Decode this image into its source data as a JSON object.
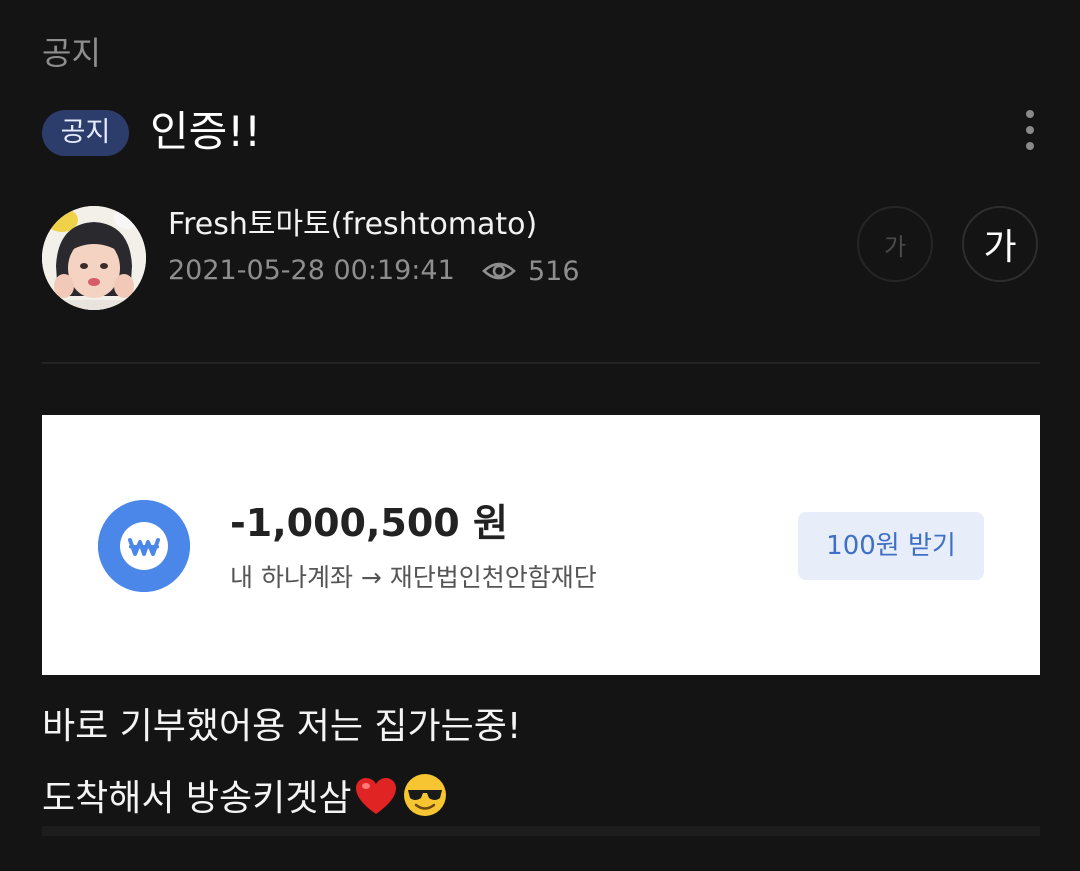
{
  "header": {
    "category": "공지",
    "badge": "공지",
    "title": "인증!!",
    "menu_icon": "more-vertical-icon"
  },
  "author": {
    "name": "Fresh토마토(freshtomato)",
    "date": "2021-05-28 00:19:41",
    "views": "516",
    "views_icon": "eye-icon"
  },
  "font_size": {
    "small_label": "가",
    "large_label": "가"
  },
  "transfer_card": {
    "amount": "-1,000,500 원",
    "route": "내 하나계좌 → 재단법인천안함재단",
    "button_label": "100원 받기",
    "coin_icon": "won-coin-icon",
    "accent_color": "#4a87e8"
  },
  "content": {
    "line1": "바로 기부했어용 저는 집가는중!",
    "line2": "도착해서 방송키겟삼",
    "emojis": [
      "red-heart-icon",
      "sunglasses-face-icon"
    ]
  },
  "colors": {
    "background": "#141414",
    "badge": "#2c3d6b"
  }
}
